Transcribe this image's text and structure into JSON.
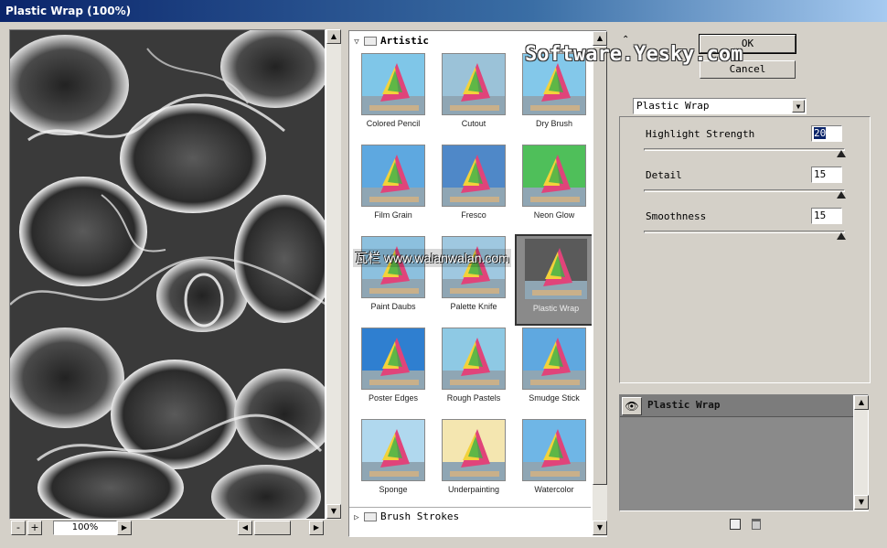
{
  "window": {
    "title": "Plastic Wrap (100%)"
  },
  "preview": {
    "zoom": "100%",
    "minus": "-",
    "plus": "+"
  },
  "gallery": {
    "category_open": "Artistic",
    "category_next": "Brush Strokes",
    "filters": [
      "Colored Pencil",
      "Cutout",
      "Dry Brush",
      "Film Grain",
      "Fresco",
      "Neon Glow",
      "Paint Daubs",
      "Palette Knife",
      "Plastic Wrap",
      "Poster Edges",
      "Rough Pastels",
      "Smudge Stick",
      "Sponge",
      "Underpainting",
      "Watercolor"
    ],
    "selected": "Plastic Wrap"
  },
  "buttons": {
    "ok": "OK",
    "cancel": "Cancel"
  },
  "filter_select": {
    "value": "Plastic Wrap"
  },
  "params": [
    {
      "label": "Highlight Strength",
      "value": "20",
      "fraction": 0.98
    },
    {
      "label": "Detail",
      "value": "15",
      "fraction": 0.98
    },
    {
      "label": "Smoothness",
      "value": "15",
      "fraction": 0.98
    }
  ],
  "layers": {
    "name": "Plastic Wrap"
  },
  "watermarks": {
    "top": "Software.Yesky.com",
    "middle": "瓦栏 www.walanwalan.com"
  },
  "colors": {
    "title_start": "#0a246a",
    "title_end": "#a6caf0",
    "face": "#d4d0c8",
    "selection": "#0a246a"
  }
}
